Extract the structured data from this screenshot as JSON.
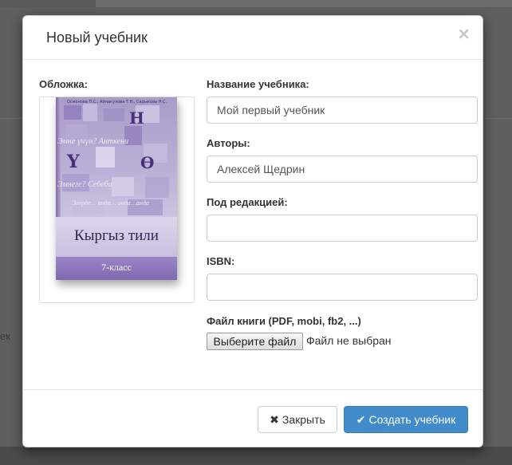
{
  "background": {
    "fragment_text": "ек"
  },
  "modal": {
    "title": "Новый учебник",
    "close_symbol": "×",
    "cover": {
      "label": "Обложка:",
      "book": {
        "authors": "Осмонова П.С., Айнакулова Т.Н., Садыкова Н.С.",
        "letters": [
          "Н",
          "Ү",
          "Ө"
        ],
        "words": [
          "Эмне үчүн? Анткени",
          "Эмнеге? Себеби",
          "Эгерде… анда… онда…анда"
        ],
        "title": "Кыргыз тили",
        "grade": "7-класс"
      }
    },
    "fields": {
      "title": {
        "label": "Название учебника:",
        "value": "Мой первый учебник"
      },
      "authors": {
        "label": "Авторы:",
        "value": "Алексей Щедрин"
      },
      "editors": {
        "label": "Под редакцией:",
        "value": ""
      },
      "isbn": {
        "label": "ISBN:",
        "value": ""
      },
      "file": {
        "label": "Файл книги (PDF, mobi, fb2, ...)",
        "button": "Выберите файл",
        "status": "Файл не выбран"
      }
    },
    "footer": {
      "close_button": "Закрыть",
      "close_icon": "times-icon",
      "create_button": "Создать учебник",
      "create_icon": "check-icon"
    }
  },
  "colors": {
    "primary": "#428bca",
    "overlay": "#5f5f5f",
    "book_accent": "#7f68b0"
  }
}
